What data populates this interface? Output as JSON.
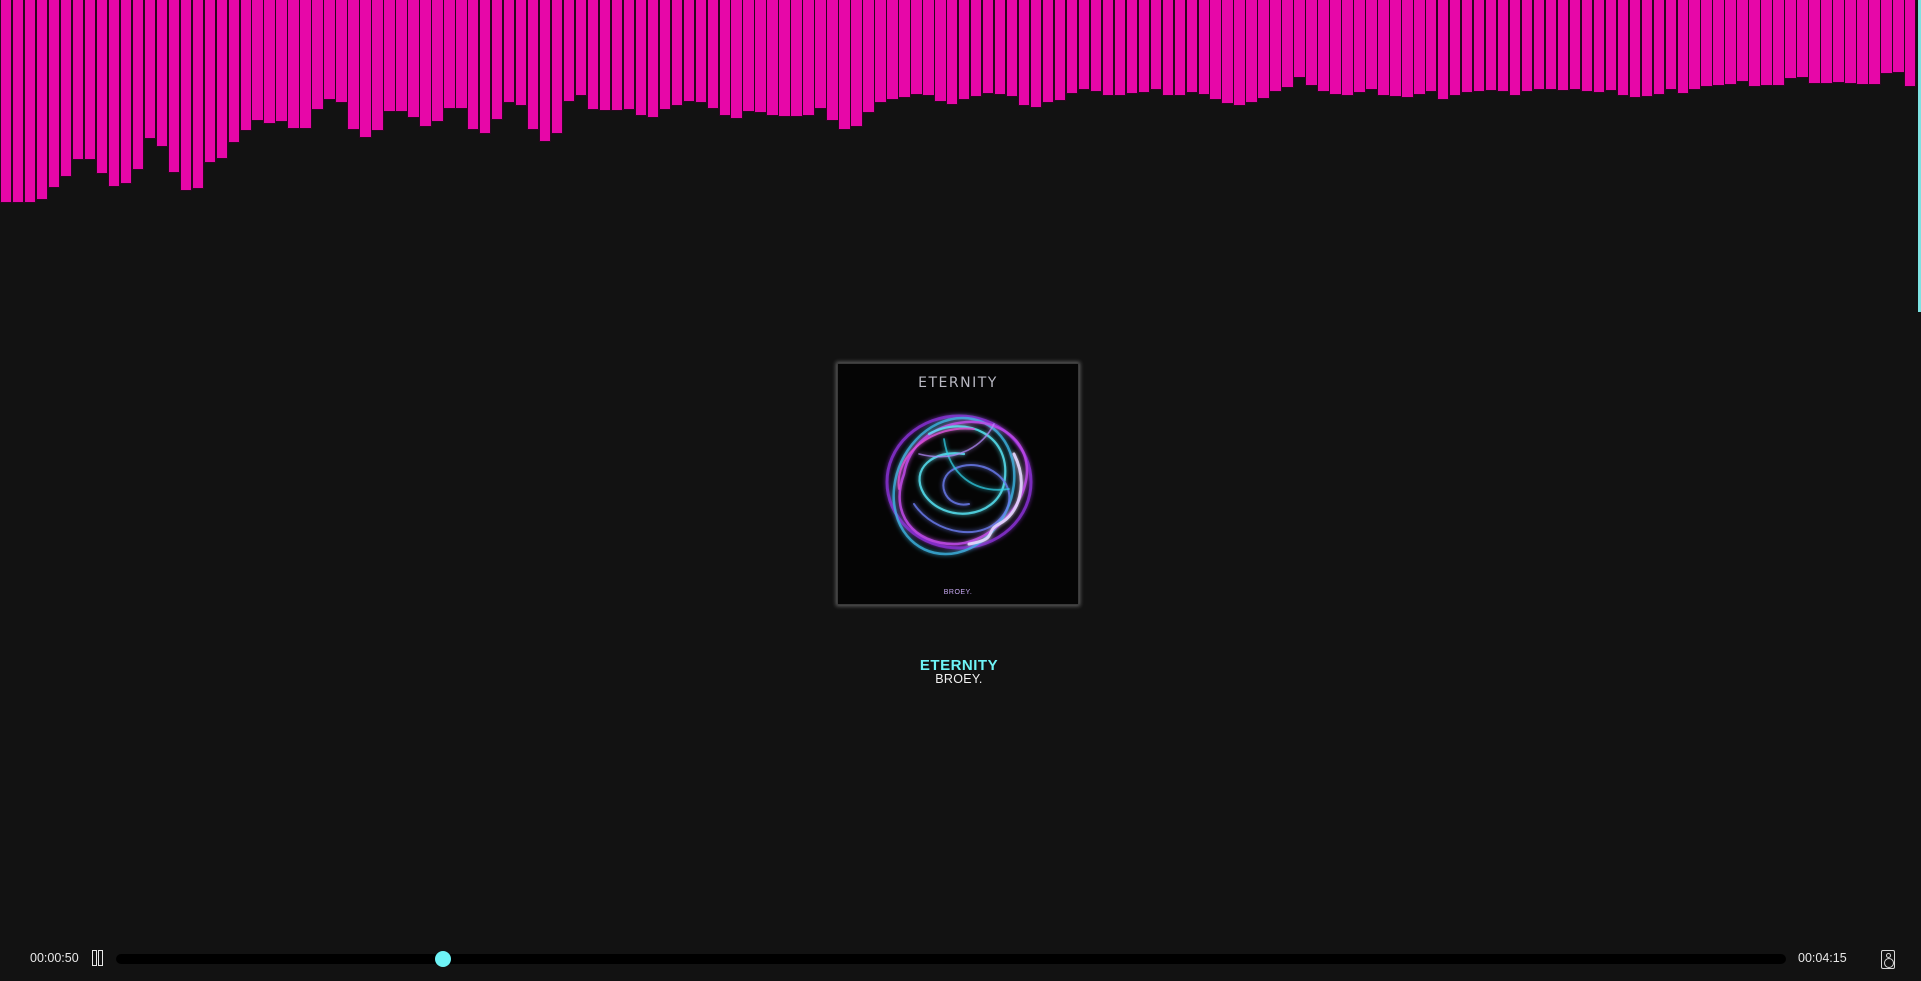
{
  "player": {
    "current_time": "00:00:50",
    "total_time": "00:04:15",
    "progress": 0.196,
    "state": "playing",
    "pause_icon": "pause-icon",
    "speaker_icon": "speaker-icon"
  },
  "track": {
    "title": "ETERNITY",
    "artist": "BROEY."
  },
  "album_art": {
    "title": "ETERNITY",
    "logo": "BROEY."
  },
  "colors": {
    "visualizer_bar": "#e707a8",
    "accent": "#6ef3f6",
    "background": "#121212"
  },
  "visualizer": {
    "levels": [
      203,
      203,
      203,
      200,
      188,
      177,
      160,
      160,
      174,
      187,
      184,
      170,
      139,
      147,
      173,
      191,
      189,
      163,
      159,
      143,
      131,
      121,
      124,
      122,
      129,
      129,
      110,
      100,
      103,
      130,
      138,
      131,
      112,
      112,
      118,
      127,
      122,
      109,
      109,
      130,
      134,
      120,
      103,
      106,
      130,
      142,
      134,
      102,
      96,
      110,
      111,
      111,
      110,
      116,
      118,
      110,
      106,
      102,
      103,
      109,
      116,
      119,
      112,
      113,
      116,
      117,
      117,
      116,
      109,
      121,
      130,
      127,
      113,
      103,
      100,
      98,
      95,
      96,
      102,
      105,
      100,
      97,
      94,
      95,
      97,
      106,
      108,
      103,
      101,
      94,
      90,
      92,
      96,
      96,
      94,
      93,
      90,
      96,
      96,
      93,
      95,
      100,
      104,
      106,
      103,
      99,
      92,
      88,
      78,
      86,
      92,
      95,
      96,
      93,
      90,
      96,
      97,
      98,
      95,
      92,
      100,
      96,
      93,
      92,
      91,
      92,
      96,
      92,
      90,
      90,
      91,
      90,
      92,
      93,
      91,
      96,
      98,
      97,
      95,
      90,
      94,
      90,
      87,
      86,
      85,
      82,
      87,
      86,
      86,
      79,
      78,
      84,
      84,
      83,
      84,
      85,
      85,
      74,
      73,
      87
    ]
  }
}
